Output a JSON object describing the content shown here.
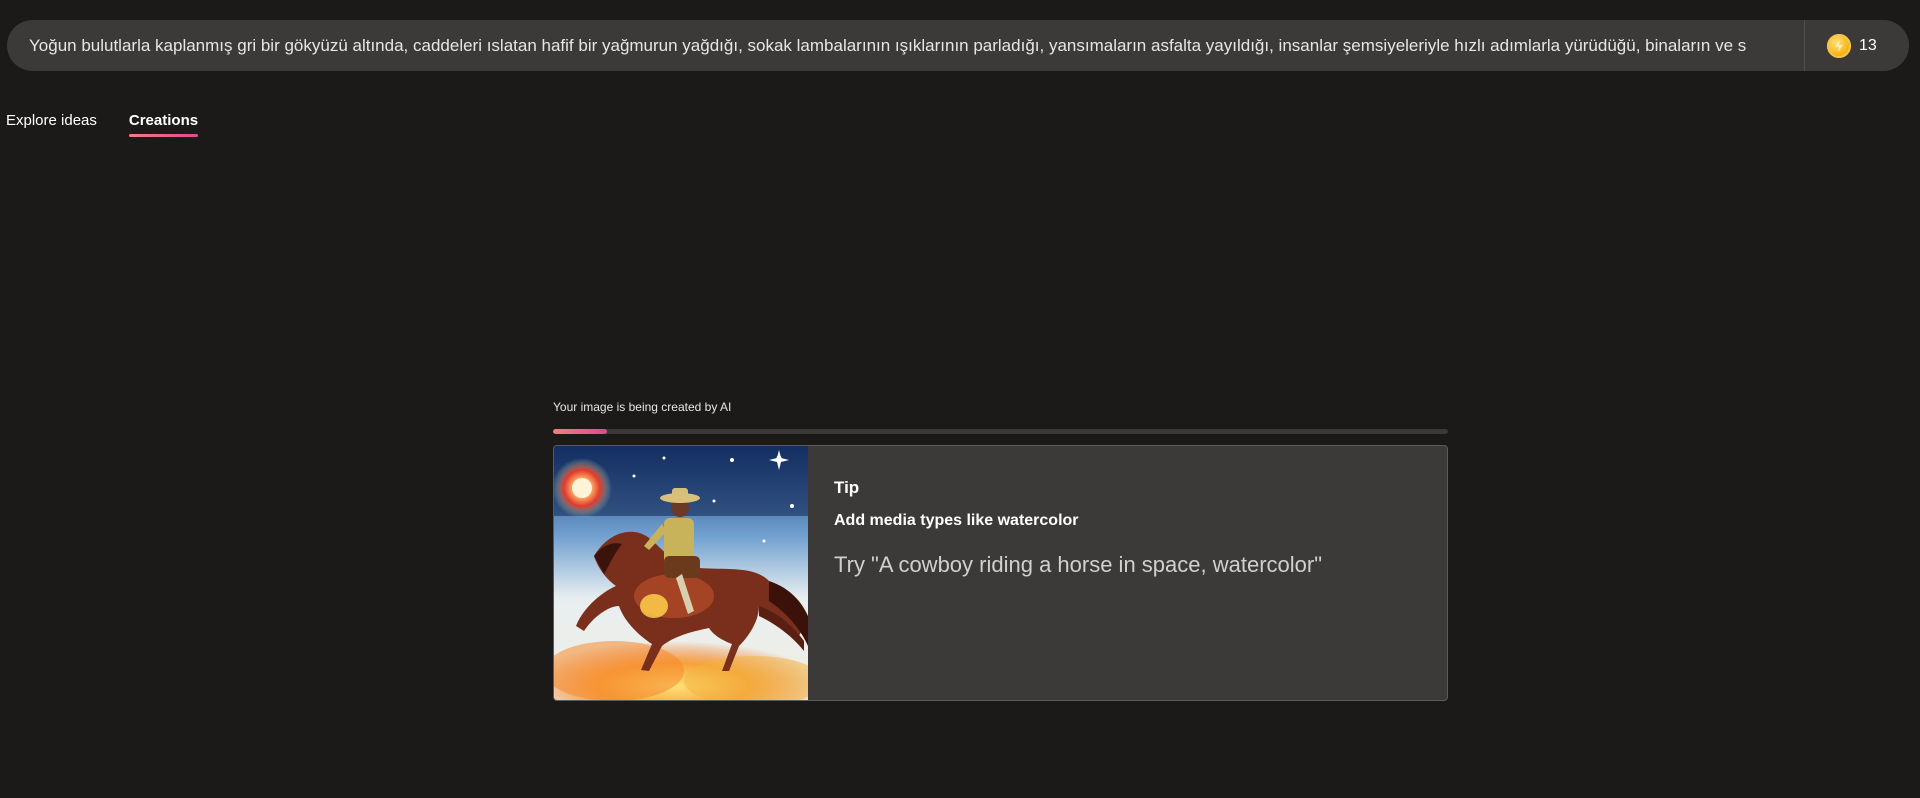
{
  "prompt": {
    "value": "Yoğun bulutlarla kaplanmış gri bir gökyüzü altında, caddeleri ıslatan hafif bir yağmurun yağdığı, sokak lambalarının ışıklarının parladığı, yansımaların asfalta yayıldığı, insanlar şemsiyeleriyle hızlı adımlarla yürüdüğü, binaların ve s"
  },
  "credits": {
    "icon": "coin-icon",
    "count": "13"
  },
  "tabs": [
    {
      "label": "Explore ideas",
      "active": false
    },
    {
      "label": "Creations",
      "active": true
    }
  ],
  "status": {
    "text": "Your image is being created by AI",
    "progress_fraction": 0.06
  },
  "tip": {
    "heading": "Tip",
    "subtitle": "Add media types like watercolor",
    "example": "Try \"A cowboy riding a horse in space, watercolor\"",
    "image": "cowboy-horse-space-watercolor-image"
  },
  "colors": {
    "background": "#1b1a19",
    "surface": "#3b3a39",
    "accent_start": "#f08080",
    "accent_end": "#e2478f",
    "coin": "#f5b820"
  }
}
